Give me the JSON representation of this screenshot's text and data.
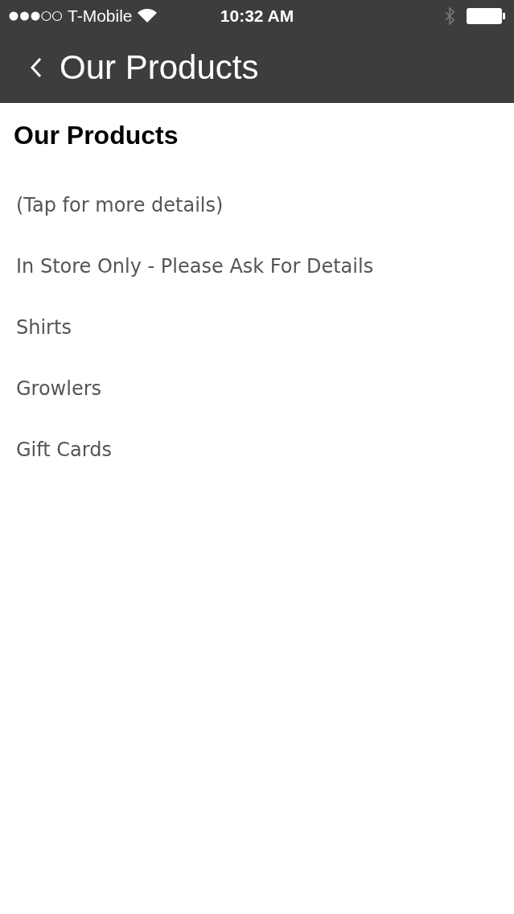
{
  "status_bar": {
    "carrier": "T-Mobile",
    "time": "10:32 AM"
  },
  "nav_bar": {
    "title": "Our Products"
  },
  "heading": "Our Products",
  "items": [
    {
      "label": "(Tap for more details)"
    },
    {
      "label": "In Store Only - Please Ask For Details"
    },
    {
      "label": "Shirts"
    },
    {
      "label": "Growlers"
    },
    {
      "label": "Gift Cards"
    }
  ]
}
